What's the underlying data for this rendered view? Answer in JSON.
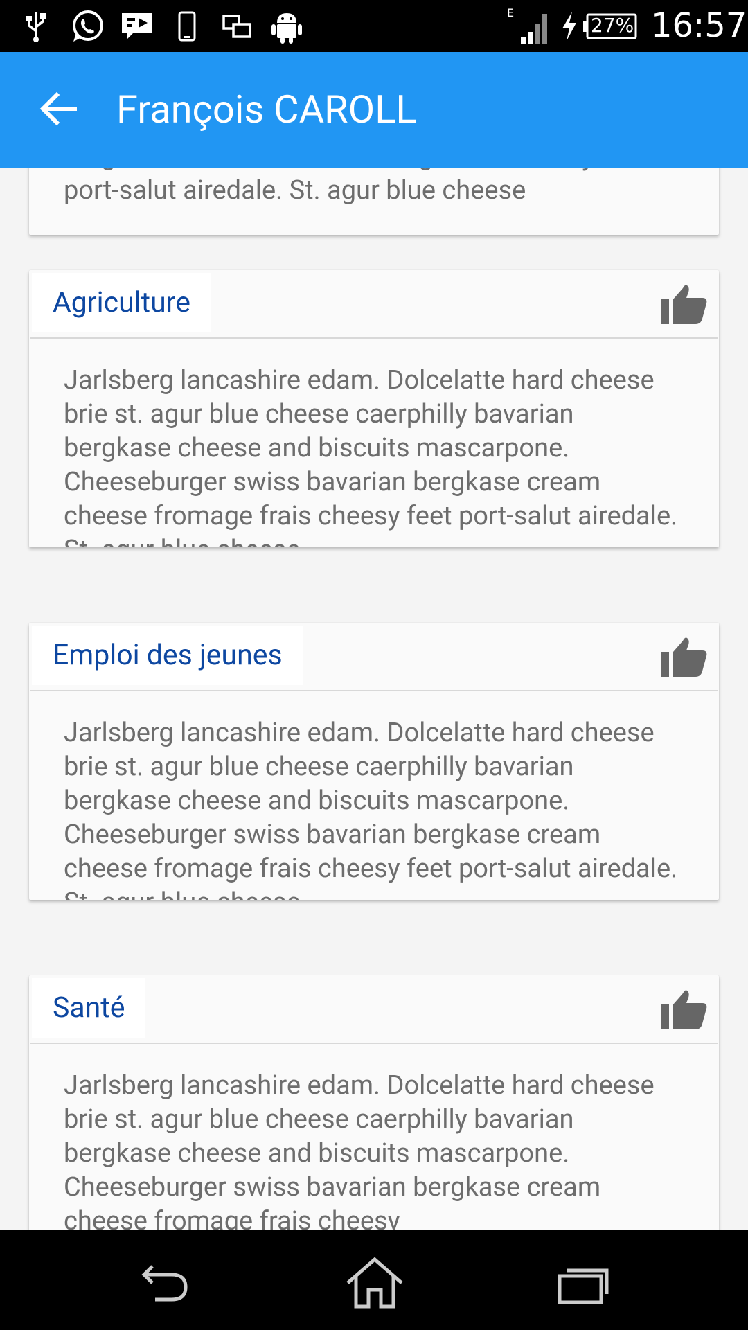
{
  "status_bar": {
    "icons": [
      "usb-icon",
      "whatsapp-icon",
      "message-icon",
      "phone-icon",
      "screens-icon",
      "android-icon"
    ],
    "network_type": "E",
    "battery": "27%",
    "time": "16:57"
  },
  "app_bar": {
    "title": "François CAROLL"
  },
  "cards": [
    {
      "title": "",
      "body": "bergkase cream cheese fromage frais cheesy feet port-salut airedale. St. agur blue cheese"
    },
    {
      "title": "Agriculture",
      "body": "Jarlsberg lancashire edam. Dolcelatte hard cheese brie st. agur blue cheese caerphilly bavarian bergkase cheese and biscuits mascarpone. Cheeseburger swiss bavarian bergkase cream cheese fromage frais cheesy feet port-salut airedale. St. agur blue cheese"
    },
    {
      "title": "Emploi des jeunes",
      "body": "Jarlsberg lancashire edam. Dolcelatte hard cheese brie st. agur blue cheese caerphilly bavarian bergkase cheese and biscuits mascarpone. Cheeseburger swiss bavarian bergkase cream cheese fromage frais cheesy feet port-salut airedale. St. agur blue cheese"
    },
    {
      "title": "Santé",
      "body": "Jarlsberg lancashire edam. Dolcelatte hard cheese brie st. agur blue cheese caerphilly bavarian bergkase cheese and biscuits mascarpone. Cheeseburger swiss bavarian bergkase cream cheese fromage frais cheesy"
    }
  ],
  "nav_bar": {
    "buttons": [
      "back-icon",
      "home-icon",
      "recents-icon"
    ]
  }
}
